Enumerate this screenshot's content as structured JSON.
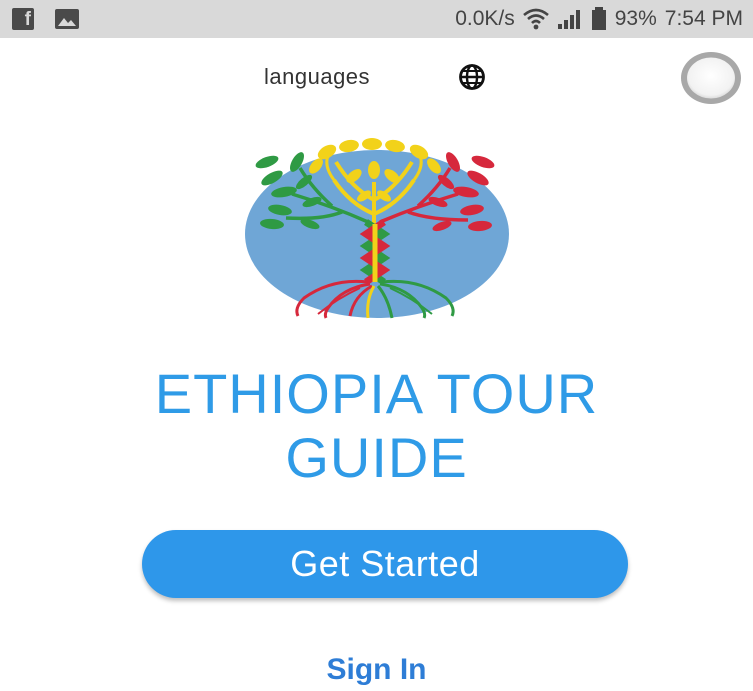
{
  "status_bar": {
    "left_icons": [
      "facebook-icon",
      "image-icon"
    ],
    "net_speed": "0.0K/s",
    "battery_percent": "93%",
    "time": "7:54 PM",
    "right_icons": [
      "wifi-icon",
      "signal-icon",
      "battery-icon"
    ]
  },
  "header": {
    "languages_label": "languages",
    "globe_icon": "globe-icon",
    "toggle_icon": "toggle-icon"
  },
  "logo": {
    "icon": "tree-logo",
    "colors": {
      "background": "#6fa6d6",
      "green": "#2f9a44",
      "yellow": "#f2d21a",
      "red": "#d6283c"
    }
  },
  "main": {
    "title_line1": "ETHIOPIA TOUR",
    "title_line2": "GUIDE",
    "get_started_label": "Get Started",
    "sign_in_label": "Sign In"
  },
  "colors": {
    "title": "#2f9be7",
    "button": "#2e97ea",
    "link": "#2e7dd6",
    "status_bar": "#d9d9d9"
  }
}
